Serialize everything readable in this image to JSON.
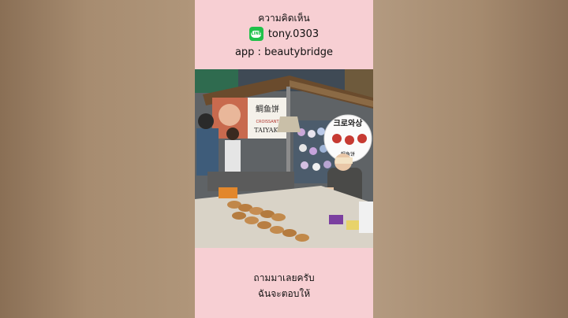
{
  "caption": {
    "title": "ความคิดเห็น",
    "line_id": "tony.0303",
    "line_badge": "LINE",
    "app": "app : beautybridge",
    "question_line1": "ถามมาเลยครับ",
    "question_line2": "ฉันจะตอบให้"
  },
  "photo": {
    "sign_chinese": "鲷鱼饼",
    "sign_croissant": "CROISSANT",
    "sign_taiyaki": "TAIYAKI",
    "badge_korean": "크로와상",
    "badge_chinese": "鲷鱼饼"
  },
  "colors": {
    "panel": "#f7cfd3",
    "line_green": "#20c14a"
  }
}
